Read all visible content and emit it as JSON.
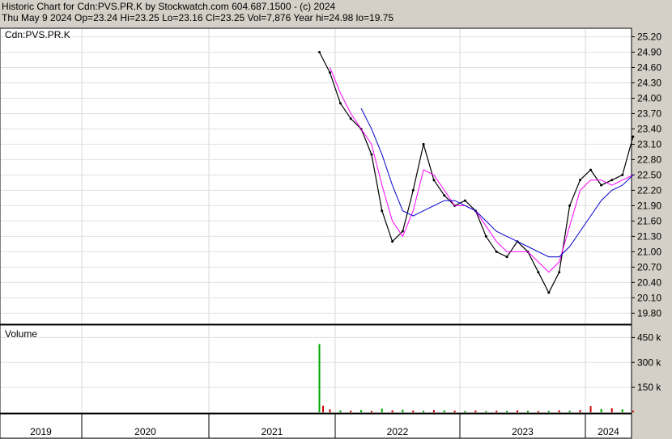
{
  "header": {
    "title_line": "Historic Chart for Cdn:PVS.PR.K by Stockwatch.com 604.687.1500 - (c) 2024",
    "quote_line": "Thu May  9 2024   Op=23.24   Hi=23.25   Lo=23.16   Cl=23.25   Vol=7,876   Year hi=24.98   lo=19.75"
  },
  "chart_data": [
    {
      "type": "line",
      "title": "Cdn:PVS.PR.K",
      "ylabel": "",
      "ylim": [
        19.6,
        25.35
      ],
      "yticks": [
        "25.20",
        "24.90",
        "24.60",
        "24.30",
        "24.00",
        "23.70",
        "23.40",
        "23.10",
        "22.80",
        "22.50",
        "22.20",
        "21.90",
        "21.60",
        "21.30",
        "21.00",
        "20.70",
        "20.40",
        "20.10",
        "19.80"
      ],
      "x_labels": [
        "2019",
        "2020",
        "2021",
        "2022",
        "2023",
        "2024"
      ],
      "grid": true,
      "series": [
        {
          "kind": "price",
          "color": "#000000",
          "x": [
            "2021-11",
            "2021-12",
            "2022-01",
            "2022-02",
            "2022-03",
            "2022-04",
            "2022-05",
            "2022-06",
            "2022-07",
            "2022-08",
            "2022-09",
            "2022-10",
            "2022-11",
            "2022-12",
            "2023-01",
            "2023-02",
            "2023-03",
            "2023-04",
            "2023-05",
            "2023-06",
            "2023-07",
            "2023-08",
            "2023-09",
            "2023-10",
            "2023-11",
            "2023-12",
            "2024-01",
            "2024-02",
            "2024-03",
            "2024-04",
            "2024-05"
          ],
          "values": [
            24.9,
            24.5,
            23.9,
            23.6,
            23.4,
            22.9,
            21.8,
            21.2,
            21.4,
            22.2,
            23.1,
            22.4,
            22.1,
            21.9,
            22.0,
            21.8,
            21.3,
            21.0,
            20.9,
            21.2,
            21.0,
            20.6,
            20.2,
            20.6,
            21.9,
            22.4,
            22.6,
            22.3,
            22.4,
            22.5,
            23.25
          ]
        },
        {
          "kind": "moving-average-short",
          "color": "#ff00ff",
          "x": [
            "2021-12",
            "2022-01",
            "2022-02",
            "2022-03",
            "2022-04",
            "2022-05",
            "2022-06",
            "2022-07",
            "2022-08",
            "2022-09",
            "2022-10",
            "2022-11",
            "2022-12",
            "2023-01",
            "2023-02",
            "2023-03",
            "2023-04",
            "2023-05",
            "2023-06",
            "2023-07",
            "2023-08",
            "2023-09",
            "2023-10",
            "2023-11",
            "2023-12",
            "2024-01",
            "2024-02",
            "2024-03",
            "2024-04",
            "2024-05"
          ],
          "values": [
            24.6,
            24.1,
            23.7,
            23.4,
            23.1,
            22.3,
            21.6,
            21.3,
            21.8,
            22.6,
            22.5,
            22.2,
            21.9,
            21.9,
            21.8,
            21.5,
            21.2,
            21.0,
            21.0,
            21.0,
            20.8,
            20.6,
            20.8,
            21.5,
            22.2,
            22.4,
            22.4,
            22.3,
            22.4,
            22.5
          ]
        },
        {
          "kind": "moving-average-long",
          "color": "#0000cc",
          "x": [
            "2022-03",
            "2022-04",
            "2022-05",
            "2022-06",
            "2022-07",
            "2022-08",
            "2022-09",
            "2022-10",
            "2022-11",
            "2022-12",
            "2023-01",
            "2023-02",
            "2023-03",
            "2023-04",
            "2023-05",
            "2023-06",
            "2023-07",
            "2023-08",
            "2023-09",
            "2023-10",
            "2023-11",
            "2023-12",
            "2024-01",
            "2024-02",
            "2024-03",
            "2024-04",
            "2024-05"
          ],
          "values": [
            23.8,
            23.4,
            22.9,
            22.3,
            21.8,
            21.7,
            21.8,
            21.9,
            22.0,
            22.0,
            21.9,
            21.8,
            21.6,
            21.4,
            21.3,
            21.2,
            21.1,
            21.0,
            20.9,
            20.9,
            21.1,
            21.4,
            21.7,
            22.0,
            22.2,
            22.3,
            22.5
          ]
        }
      ]
    },
    {
      "type": "bar",
      "title": "Volume",
      "ylim": [
        0,
        520
      ],
      "yticks": [
        "450 k",
        "300 k",
        "150 k"
      ],
      "x_labels": [
        "2019",
        "2020",
        "2021",
        "2022",
        "2023",
        "2024"
      ],
      "series": [
        {
          "name": "",
          "x": [
            "2021-11",
            "2021-11b",
            "2021-12",
            "2022-01",
            "2022-02",
            "2022-03",
            "2022-04",
            "2022-05",
            "2022-06",
            "2022-07",
            "2022-08",
            "2022-09",
            "2022-10",
            "2022-11",
            "2022-12",
            "2023-01",
            "2023-02",
            "2023-03",
            "2023-04",
            "2023-05",
            "2023-06",
            "2023-07",
            "2023-08",
            "2023-09",
            "2023-10",
            "2023-11",
            "2023-12",
            "2024-01",
            "2024-02",
            "2024-03",
            "2024-04",
            "2024-05"
          ],
          "values": [
            410,
            40,
            18,
            12,
            10,
            14,
            9,
            22,
            12,
            16,
            11,
            10,
            14,
            12,
            10,
            9,
            11,
            8,
            10,
            9,
            12,
            10,
            8,
            9,
            12,
            10,
            14,
            38,
            20,
            24,
            18,
            10
          ],
          "colors": [
            "#00aa00",
            "#cc0000",
            "#cc0000",
            "#00aa00",
            "#cc0000",
            "#00aa00",
            "#cc0000",
            "#00aa00",
            "#cc0000",
            "#00aa00",
            "#cc0000",
            "#00aa00",
            "#cc0000",
            "#00aa00",
            "#cc0000",
            "#00aa00",
            "#cc0000",
            "#00aa00",
            "#cc0000",
            "#00aa00",
            "#cc0000",
            "#00aa00",
            "#cc0000",
            "#00aa00",
            "#cc0000",
            "#00aa00",
            "#cc0000",
            "#cc0000",
            "#00aa00",
            "#cc0000",
            "#00aa00",
            "#cc0000"
          ]
        }
      ]
    }
  ]
}
